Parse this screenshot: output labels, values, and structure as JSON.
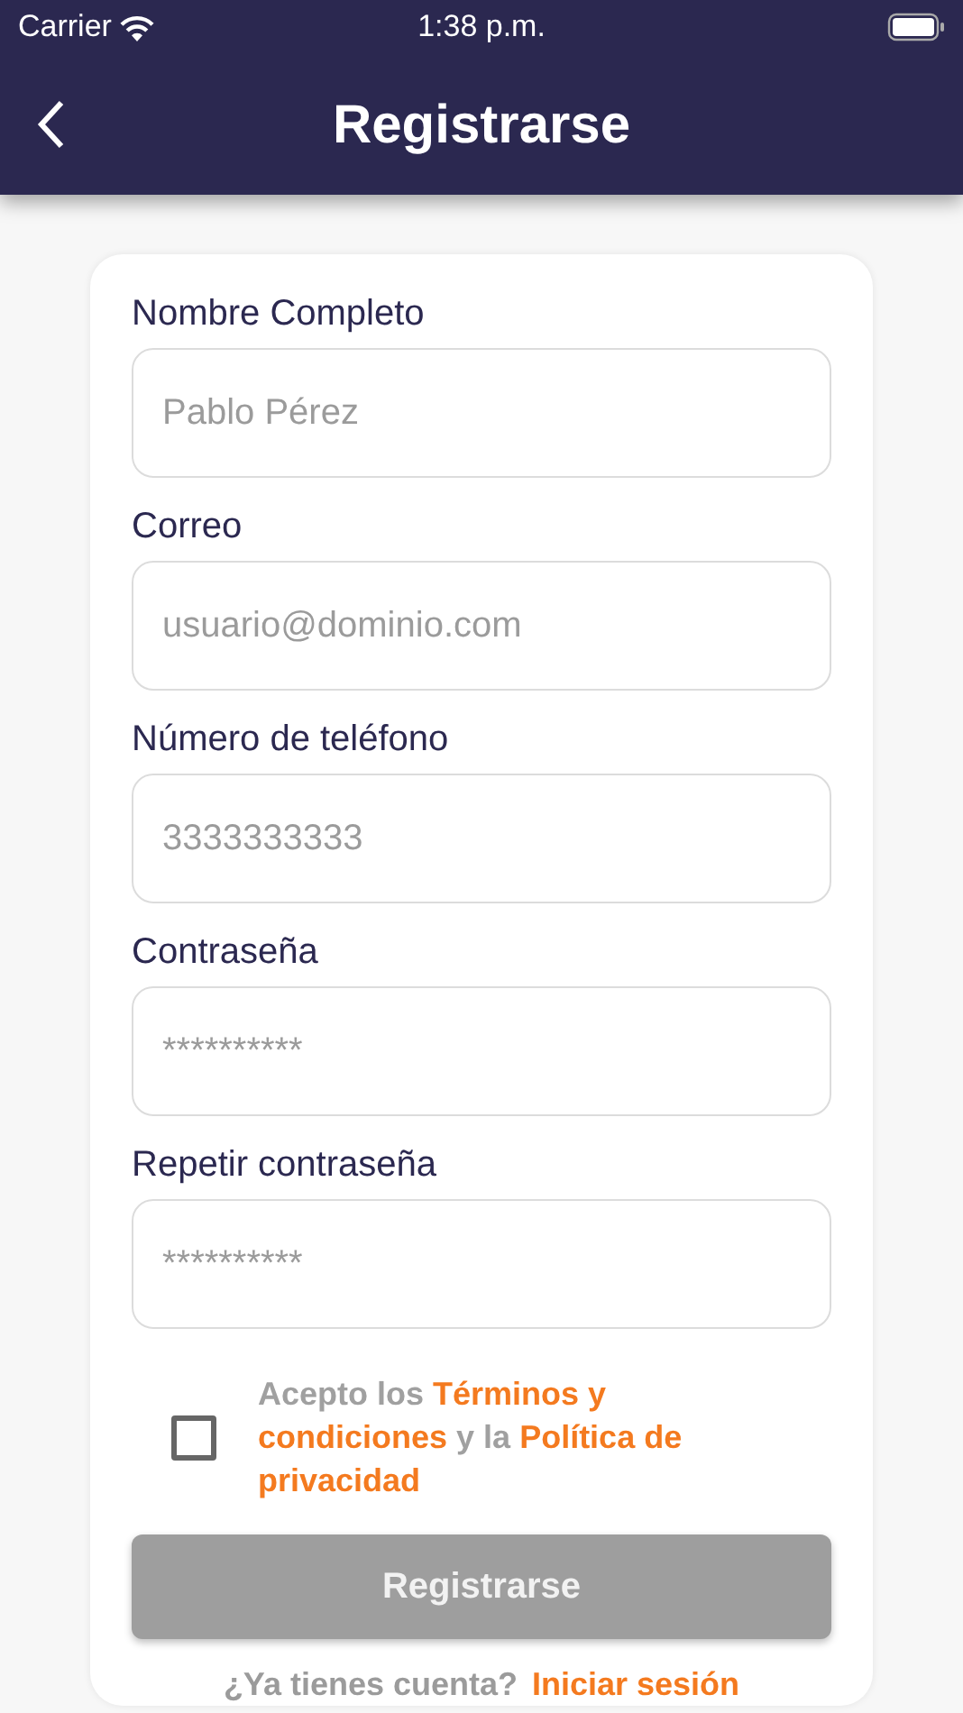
{
  "status_bar": {
    "carrier": "Carrier",
    "time": "1:38 p.m."
  },
  "nav": {
    "title": "Registrarse"
  },
  "fields": [
    {
      "label": "Nombre Completo",
      "placeholder": "Pablo Pérez"
    },
    {
      "label": "Correo",
      "placeholder": "usuario@dominio.com"
    },
    {
      "label": "Número de teléfono",
      "placeholder": "3333333333"
    },
    {
      "label": "Contraseña",
      "placeholder": "**********"
    },
    {
      "label": "Repetir contraseña",
      "placeholder": "**********"
    }
  ],
  "terms": {
    "checked": false,
    "text": "Acepto los **Términos y condiciones** y la **Política de privacidad**"
  },
  "submit": {
    "label": "Registrarse",
    "disabled": true
  },
  "login_prompt": {
    "text": "¿Ya tienes cuenta?",
    "link": "Iniciar sesión"
  }
}
